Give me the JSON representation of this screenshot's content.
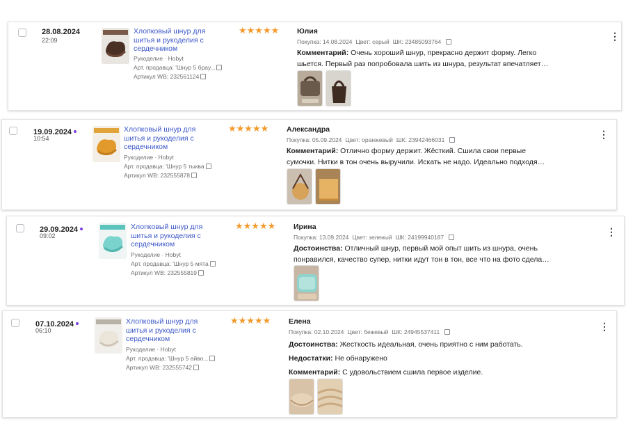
{
  "colors": {
    "link": "#3d58c9",
    "star": "#f39a2b",
    "new_dot": "#7b3fe4"
  },
  "reviews": [
    {
      "date": "28.08.2024",
      "time": "22:09",
      "new_dot": false,
      "product_title": "Хлопковый шнур для шитья и рукоделия с сердечником",
      "category": "Рукоделие · Hobyt",
      "seller_article": "Арт. продавца: 'Шнур 5 брау...",
      "wb_article": "Артикул WB: 232561124",
      "rating": 5,
      "stars": "★★★★★",
      "author": "Юлия",
      "purchase": "Покупка: 14.08.2024",
      "color": "Цвет: серый",
      "barcode": "ШК: 23485093764",
      "lines": [
        {
          "label": "Комментарий:",
          "text": " Очень хороший шнур, прекрасно держит форму. Легко"
        },
        {
          "label": "",
          "text": "шьется. Первый раз попробовала шить из шнура, результат впечатляет…"
        }
      ],
      "photos": [
        "photo-bag-grey",
        "photo-bag-brown"
      ]
    },
    {
      "date": "19.09.2024",
      "time": "10:54",
      "new_dot": true,
      "product_title": "Хлопковый шнур для шитья и рукоделия с сердечником",
      "category": "Рукоделие · Hobyt",
      "seller_article": "Арт. продавца: 'Шнур 5 тыква",
      "wb_article": "Артикул WB: 232555878",
      "rating": 5,
      "stars": "★★★★★",
      "author": "Александра",
      "purchase": "Покупка: 05.09.2024",
      "color": "Цвет: оранжевый",
      "barcode": "ШК: 23942466031",
      "lines": [
        {
          "label": "Комментарий:",
          "text": " Отлично форму держит. Жёсткий. Сшила свои первые"
        },
        {
          "label": "",
          "text": "сумочки. Нитки в тон очень выручили. Искать не надо. Идеально подходя…"
        }
      ],
      "photos": [
        "photo-round-bag",
        "photo-orange-bag"
      ]
    },
    {
      "date": "29.09.2024",
      "time": "09:02",
      "new_dot": true,
      "product_title": "Хлопковый шнур для шитья и рукоделия с сердечником",
      "category": "Рукоделие · Hobyt",
      "seller_article": "Арт. продавца: 'Шнур 5 мята",
      "wb_article": "Артикул WB: 232555819",
      "rating": 5,
      "stars": "★★★★★",
      "author": "Ирина",
      "purchase": "Покупка: 13.09.2024",
      "color": "Цвет: зеленый",
      "barcode": "ШК: 24199940187",
      "lines": [
        {
          "label": "Достоинства:",
          "text": " Отличный шнур, первый мой опыт шить из шнура, очень"
        },
        {
          "label": "",
          "text": "понравился, качество супер, нитки идут тон в тон, все что на фото сдела…"
        }
      ],
      "photos": [
        "photo-mint-basket"
      ]
    },
    {
      "date": "07.10.2024",
      "time": "06:10",
      "new_dot": true,
      "product_title": "Хлопковый шнур для шитья и рукоделия с сердечником",
      "category": "Рукоделие · Hobyt",
      "seller_article": "Арт. продавца: 'Шнур 5 айво...",
      "wb_article": "Артикул WB: 232555742",
      "rating": 5,
      "stars": "★★★★★",
      "author": "Елена",
      "purchase": "Покупка: 02.10.2024",
      "color": "Цвет: бежевый",
      "barcode": "ШК: 24945537411",
      "lines": [
        {
          "label": "Достоинства:",
          "text": " Жесткость идеальная, очень приятно с ним работать."
        },
        {
          "label": "Недостатки:",
          "text": " Не обнаружено"
        },
        {
          "label": "Комментарий:",
          "text": " С удовольствием сшила первое изделие."
        }
      ],
      "photos": [
        "photo-beige-basket",
        "photo-beige-closeup"
      ]
    }
  ]
}
